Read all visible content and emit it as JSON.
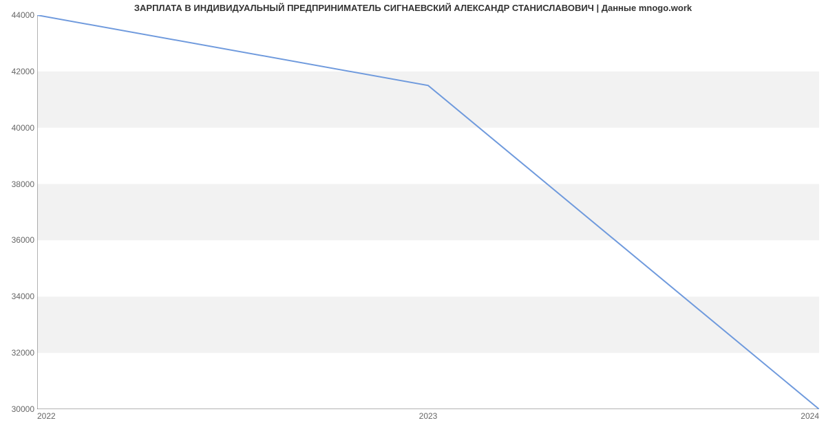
{
  "chart_data": {
    "type": "line",
    "title": "ЗАРПЛАТА В ИНДИВИДУАЛЬНЫЙ ПРЕДПРИНИМАТЕЛЬ СИГНАЕВСКИЙ АЛЕКСАНДР СТАНИСЛАВОВИЧ | Данные mnogo.work",
    "x": [
      2022,
      2023,
      2024
    ],
    "values": [
      44000,
      41500,
      30000
    ],
    "xlabel": "",
    "ylabel": "",
    "xlim": [
      2022,
      2024
    ],
    "ylim": [
      30000,
      44000
    ],
    "x_ticks": [
      2022,
      2023,
      2024
    ],
    "y_ticks": [
      30000,
      32000,
      34000,
      36000,
      38000,
      40000,
      42000,
      44000
    ],
    "line_color": "#6f9add",
    "band_color": "#f2f2f2",
    "axis_color": "#666666"
  }
}
